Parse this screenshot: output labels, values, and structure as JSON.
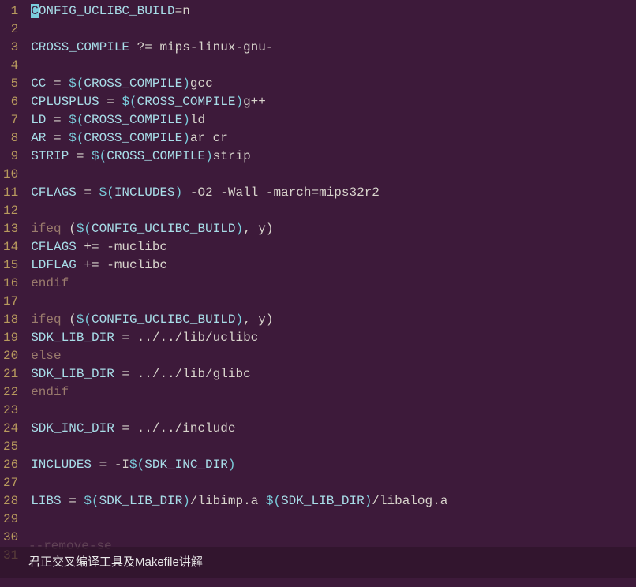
{
  "overlay_caption": "君正交叉编译工具及Makefile讲解",
  "faded_text": "--remove-se",
  "lines": [
    {
      "num": "1",
      "segments": [
        {
          "cls": "cursor-block",
          "t": "C"
        },
        {
          "cls": "tok-var",
          "t": "ONFIG_UCLIBC_BUILD"
        },
        {
          "cls": "tok-op",
          "t": "=n"
        }
      ]
    },
    {
      "num": "2",
      "segments": []
    },
    {
      "num": "3",
      "segments": [
        {
          "cls": "tok-var",
          "t": "CROSS_COMPILE"
        },
        {
          "cls": "tok-op",
          "t": " ?= "
        },
        {
          "cls": "tok-val",
          "t": "mips-linux-gnu-"
        }
      ]
    },
    {
      "num": "4",
      "segments": []
    },
    {
      "num": "5",
      "segments": [
        {
          "cls": "tok-var",
          "t": "CC"
        },
        {
          "cls": "tok-op",
          "t": " = "
        },
        {
          "cls": "tok-func",
          "t": "$("
        },
        {
          "cls": "tok-var",
          "t": "CROSS_COMPILE"
        },
        {
          "cls": "tok-func",
          "t": ")"
        },
        {
          "cls": "tok-val",
          "t": "gcc"
        }
      ]
    },
    {
      "num": "6",
      "segments": [
        {
          "cls": "tok-var",
          "t": "CPLUSPLUS"
        },
        {
          "cls": "tok-op",
          "t": " = "
        },
        {
          "cls": "tok-func",
          "t": "$("
        },
        {
          "cls": "tok-var",
          "t": "CROSS_COMPILE"
        },
        {
          "cls": "tok-func",
          "t": ")"
        },
        {
          "cls": "tok-val",
          "t": "g++"
        }
      ]
    },
    {
      "num": "7",
      "segments": [
        {
          "cls": "tok-var",
          "t": "LD"
        },
        {
          "cls": "tok-op",
          "t": " = "
        },
        {
          "cls": "tok-func",
          "t": "$("
        },
        {
          "cls": "tok-var",
          "t": "CROSS_COMPILE"
        },
        {
          "cls": "tok-func",
          "t": ")"
        },
        {
          "cls": "tok-val",
          "t": "ld"
        }
      ]
    },
    {
      "num": "8",
      "segments": [
        {
          "cls": "tok-var",
          "t": "AR"
        },
        {
          "cls": "tok-op",
          "t": " = "
        },
        {
          "cls": "tok-func",
          "t": "$("
        },
        {
          "cls": "tok-var",
          "t": "CROSS_COMPILE"
        },
        {
          "cls": "tok-func",
          "t": ")"
        },
        {
          "cls": "tok-val",
          "t": "ar cr"
        }
      ]
    },
    {
      "num": "9",
      "segments": [
        {
          "cls": "tok-var",
          "t": "STRIP"
        },
        {
          "cls": "tok-op",
          "t": " = "
        },
        {
          "cls": "tok-func",
          "t": "$("
        },
        {
          "cls": "tok-var",
          "t": "CROSS_COMPILE"
        },
        {
          "cls": "tok-func",
          "t": ")"
        },
        {
          "cls": "tok-val",
          "t": "strip"
        }
      ]
    },
    {
      "num": "10",
      "segments": []
    },
    {
      "num": "11",
      "segments": [
        {
          "cls": "tok-var",
          "t": "CFLAGS"
        },
        {
          "cls": "tok-op",
          "t": " = "
        },
        {
          "cls": "tok-func",
          "t": "$("
        },
        {
          "cls": "tok-var",
          "t": "INCLUDES"
        },
        {
          "cls": "tok-func",
          "t": ")"
        },
        {
          "cls": "tok-val",
          "t": " -O2 -Wall -march=mips32r2"
        }
      ]
    },
    {
      "num": "12",
      "segments": []
    },
    {
      "num": "13",
      "segments": [
        {
          "cls": "tok-kw",
          "t": "ifeq "
        },
        {
          "cls": "tok-paren",
          "t": "("
        },
        {
          "cls": "tok-func",
          "t": "$("
        },
        {
          "cls": "tok-var",
          "t": "CONFIG_UCLIBC_BUILD"
        },
        {
          "cls": "tok-func",
          "t": ")"
        },
        {
          "cls": "tok-arg",
          "t": ", y"
        },
        {
          "cls": "tok-paren",
          "t": ")"
        }
      ]
    },
    {
      "num": "14",
      "segments": [
        {
          "cls": "tok-var",
          "t": "CFLAGS"
        },
        {
          "cls": "tok-op",
          "t": " += "
        },
        {
          "cls": "tok-val",
          "t": "-muclibc"
        }
      ]
    },
    {
      "num": "15",
      "segments": [
        {
          "cls": "tok-var",
          "t": "LDFLAG"
        },
        {
          "cls": "tok-op",
          "t": " += "
        },
        {
          "cls": "tok-val",
          "t": "-muclibc"
        }
      ]
    },
    {
      "num": "16",
      "segments": [
        {
          "cls": "tok-kw",
          "t": "endif"
        }
      ]
    },
    {
      "num": "17",
      "segments": []
    },
    {
      "num": "18",
      "segments": [
        {
          "cls": "tok-kw",
          "t": "ifeq "
        },
        {
          "cls": "tok-paren",
          "t": "("
        },
        {
          "cls": "tok-func",
          "t": "$("
        },
        {
          "cls": "tok-var",
          "t": "CONFIG_UCLIBC_BUILD"
        },
        {
          "cls": "tok-func",
          "t": ")"
        },
        {
          "cls": "tok-arg",
          "t": ", y"
        },
        {
          "cls": "tok-paren",
          "t": ")"
        }
      ]
    },
    {
      "num": "19",
      "segments": [
        {
          "cls": "tok-var",
          "t": "SDK_LIB_DIR"
        },
        {
          "cls": "tok-op",
          "t": " = "
        },
        {
          "cls": "tok-val",
          "t": "../../lib/uclibc"
        }
      ]
    },
    {
      "num": "20",
      "segments": [
        {
          "cls": "tok-kw",
          "t": "else"
        }
      ]
    },
    {
      "num": "21",
      "segments": [
        {
          "cls": "tok-var",
          "t": "SDK_LIB_DIR"
        },
        {
          "cls": "tok-op",
          "t": " = "
        },
        {
          "cls": "tok-val",
          "t": "../../lib/glibc"
        }
      ]
    },
    {
      "num": "22",
      "segments": [
        {
          "cls": "tok-kw",
          "t": "endif"
        }
      ]
    },
    {
      "num": "23",
      "segments": []
    },
    {
      "num": "24",
      "segments": [
        {
          "cls": "tok-var",
          "t": "SDK_INC_DIR"
        },
        {
          "cls": "tok-op",
          "t": " = "
        },
        {
          "cls": "tok-val",
          "t": "../../include"
        }
      ]
    },
    {
      "num": "25",
      "segments": []
    },
    {
      "num": "26",
      "segments": [
        {
          "cls": "tok-var",
          "t": "INCLUDES"
        },
        {
          "cls": "tok-op",
          "t": " = "
        },
        {
          "cls": "tok-val",
          "t": "-I"
        },
        {
          "cls": "tok-func",
          "t": "$("
        },
        {
          "cls": "tok-var",
          "t": "SDK_INC_DIR"
        },
        {
          "cls": "tok-func",
          "t": ")"
        }
      ]
    },
    {
      "num": "27",
      "segments": []
    },
    {
      "num": "28",
      "segments": [
        {
          "cls": "tok-var",
          "t": "LIBS"
        },
        {
          "cls": "tok-op",
          "t": " = "
        },
        {
          "cls": "tok-func",
          "t": "$("
        },
        {
          "cls": "tok-var",
          "t": "SDK_LIB_DIR"
        },
        {
          "cls": "tok-func",
          "t": ")"
        },
        {
          "cls": "tok-val",
          "t": "/libimp.a "
        },
        {
          "cls": "tok-func",
          "t": "$("
        },
        {
          "cls": "tok-var",
          "t": "SDK_LIB_DIR"
        },
        {
          "cls": "tok-func",
          "t": ")"
        },
        {
          "cls": "tok-val",
          "t": "/libalog.a"
        }
      ]
    },
    {
      "num": "29",
      "segments": []
    },
    {
      "num": "30",
      "segments": []
    },
    {
      "num": "31",
      "segments": []
    }
  ]
}
